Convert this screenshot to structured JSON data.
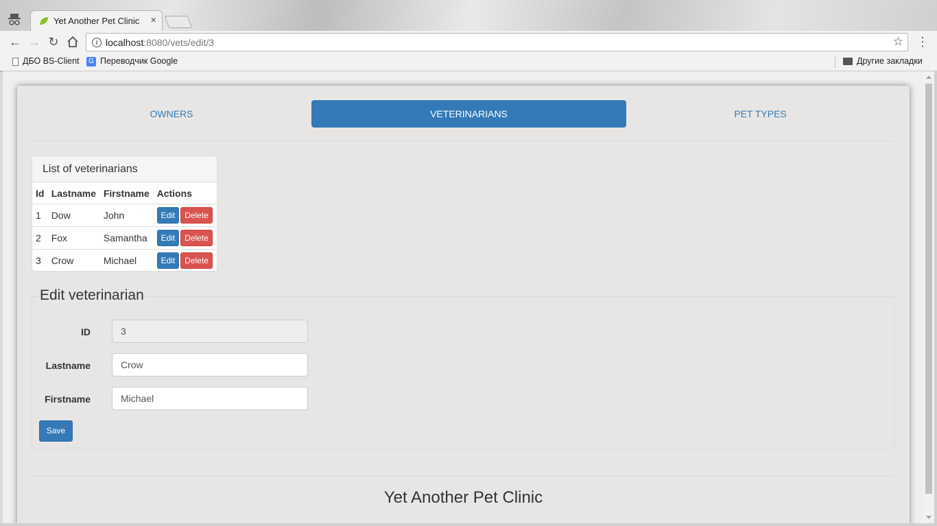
{
  "browser": {
    "tab_title": "Yet Another Pet Clinic",
    "tab_close": "×",
    "url_host": "localhost",
    "url_rest": ":8080/vets/edit/3",
    "bookmarks": [
      {
        "label": "ДБО BS-Client",
        "icon": "document-icon"
      },
      {
        "label": "Переводчик Google",
        "icon": "google-translate-icon"
      }
    ],
    "other_bookmarks": "Другие закладки"
  },
  "nav": {
    "owners": "OWNERS",
    "vets": "VETERINARIANS",
    "pet_types": "PET TYPES",
    "active": "VETERINARIANS"
  },
  "list": {
    "title": "List of veterinarians",
    "columns": [
      "Id",
      "Lastname",
      "Firstname",
      "Actions"
    ],
    "rows": [
      {
        "id": "1",
        "lastname": "Dow",
        "firstname": "John"
      },
      {
        "id": "2",
        "lastname": "Fox",
        "firstname": "Samantha"
      },
      {
        "id": "3",
        "lastname": "Crow",
        "firstname": "Michael"
      }
    ],
    "edit_label": "Edit",
    "delete_label": "Delete"
  },
  "form": {
    "legend": "Edit veterinarian",
    "id_label": "ID",
    "id_value": "3",
    "lastname_label": "Lastname",
    "lastname_value": "Crow",
    "firstname_label": "Firstname",
    "firstname_value": "Michael",
    "save_label": "Save"
  },
  "footer": {
    "title": "Yet Another Pet Clinic"
  },
  "colors": {
    "primary": "#337ab7",
    "danger": "#d9534f",
    "page_bg": "#e8e6e4"
  }
}
